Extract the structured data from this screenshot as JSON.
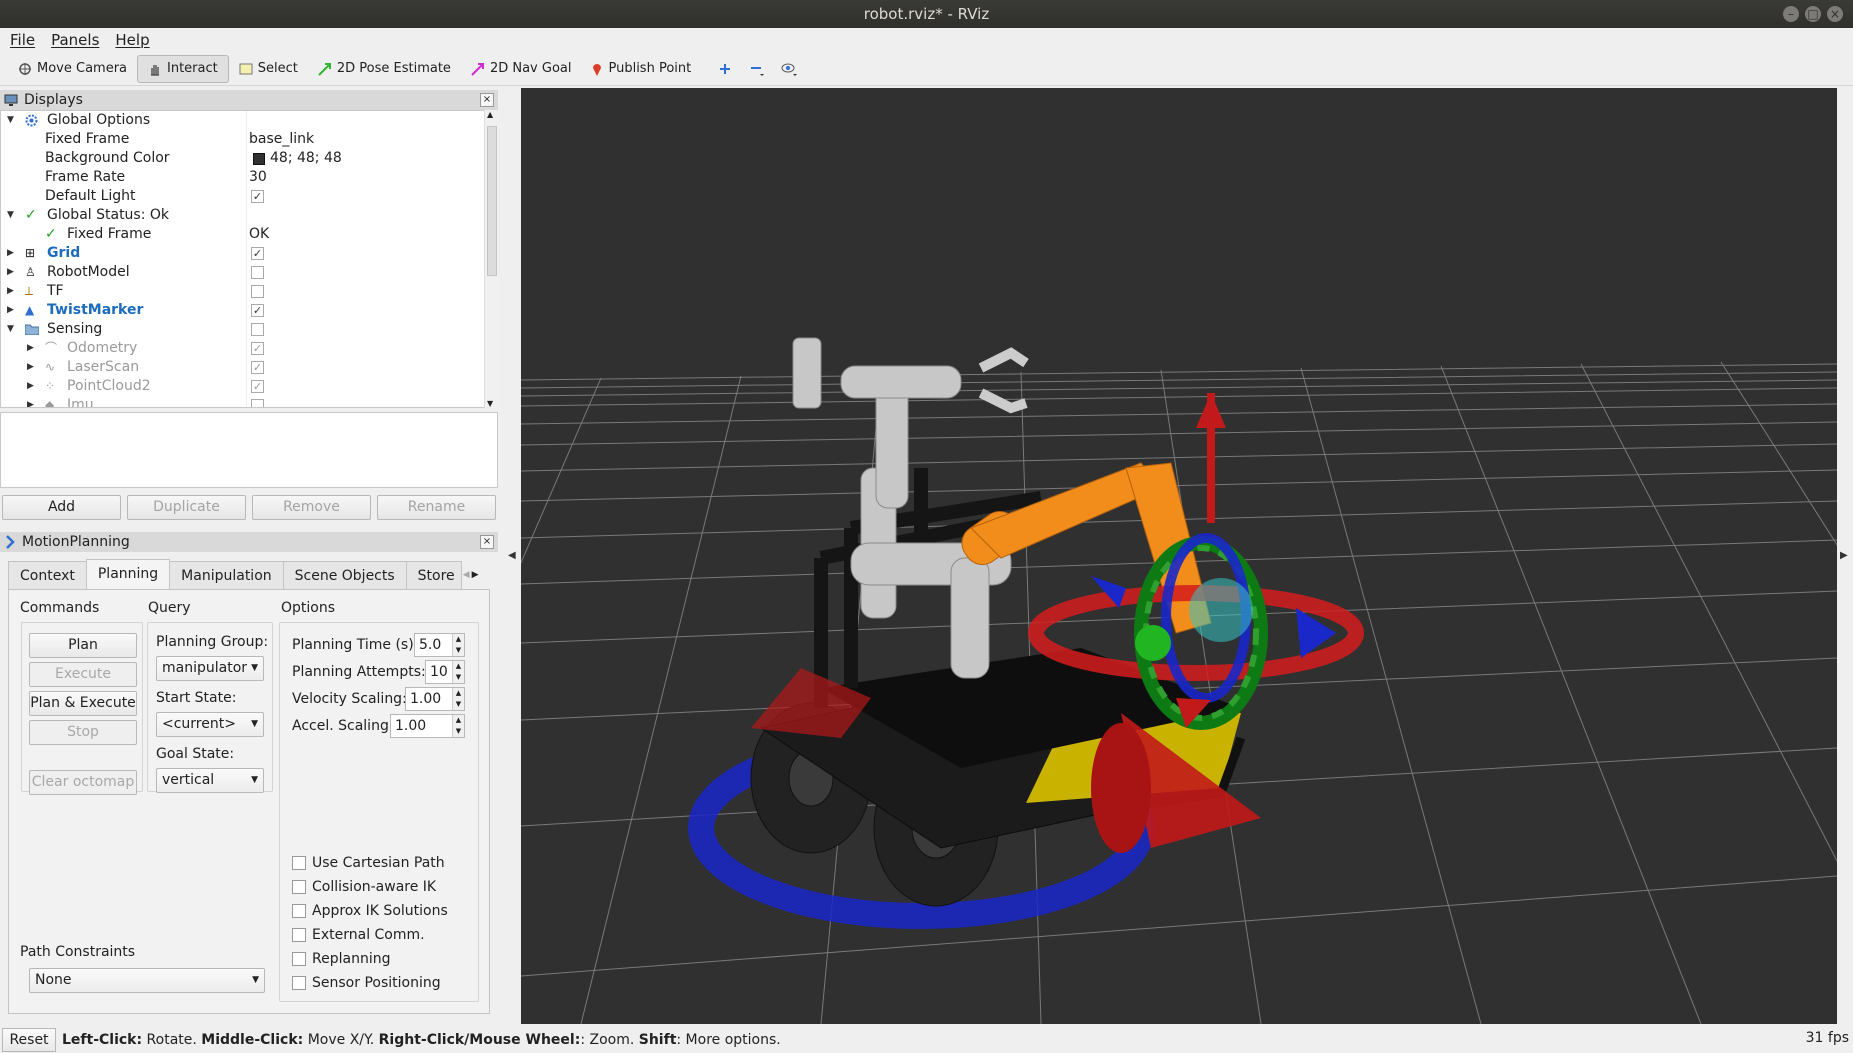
{
  "window": {
    "title": "robot.rviz* - RViz"
  },
  "menu": [
    "File",
    "Panels",
    "Help"
  ],
  "toolbar": {
    "move_camera": "Move Camera",
    "interact": "Interact",
    "select": "Select",
    "pose_estimate": "2D Pose Estimate",
    "nav_goal": "2D Nav Goal",
    "publish_point": "Publish Point"
  },
  "displays": {
    "title": "Displays",
    "global_options": "Global Options",
    "fixed_frame_label": "Fixed Frame",
    "fixed_frame_value": "base_link",
    "bg_color_label": "Background Color",
    "bg_color_value": "48; 48; 48",
    "frame_rate_label": "Frame Rate",
    "frame_rate_value": "30",
    "default_light_label": "Default Light",
    "global_status": "Global Status: Ok",
    "status_fixed_frame": "Fixed Frame",
    "status_fixed_frame_value": "OK",
    "grid": "Grid",
    "robot_model": "RobotModel",
    "tf": "TF",
    "twist_marker": "TwistMarker",
    "sensing": "Sensing",
    "odometry": "Odometry",
    "laserscan": "LaserScan",
    "pointcloud2": "PointCloud2",
    "imu": "Imu"
  },
  "display_buttons": {
    "add": "Add",
    "duplicate": "Duplicate",
    "remove": "Remove",
    "rename": "Rename"
  },
  "motion": {
    "title": "MotionPlanning",
    "tabs": [
      "Context",
      "Planning",
      "Manipulation",
      "Scene Objects",
      "Store"
    ],
    "commands_title": "Commands",
    "query_title": "Query",
    "options_title": "Options",
    "plan": "Plan",
    "execute": "Execute",
    "plan_execute": "Plan & Execute",
    "stop": "Stop",
    "clear_octomap": "Clear octomap",
    "planning_group_label": "Planning Group:",
    "planning_group": "manipulator",
    "start_state_label": "Start State:",
    "start_state": "<current>",
    "goal_state_label": "Goal State:",
    "goal_state": "vertical",
    "planning_time_label": "Planning Time (s):",
    "planning_time": "5.0",
    "planning_attempts_label": "Planning Attempts:",
    "planning_attempts": "10",
    "velocity_label": "Velocity Scaling:",
    "velocity": "1.00",
    "accel_label": "Accel. Scaling:",
    "accel": "1.00",
    "cb_cartesian": "Use Cartesian Path",
    "cb_collision": "Collision-aware IK",
    "cb_approx": "Approx IK Solutions",
    "cb_external": "External Comm.",
    "cb_replanning": "Replanning",
    "cb_sensor": "Sensor Positioning",
    "path_constraints_label": "Path Constraints",
    "path_constraints": "None"
  },
  "status": {
    "reset": "Reset",
    "left_click_b": "Left-Click:",
    "left_click": " Rotate. ",
    "middle_click_b": "Middle-Click:",
    "middle_click": " Move X/Y. ",
    "right_click_b": "Right-Click/Mouse Wheel:",
    "right_click": ": Zoom. ",
    "shift_b": "Shift",
    "shift": ": More options.",
    "fps": "31 fps"
  },
  "colors": {
    "viewport_bg": "#303030",
    "arm_orange": "#f28c1a",
    "chassis_yellow": "#c9b200"
  }
}
